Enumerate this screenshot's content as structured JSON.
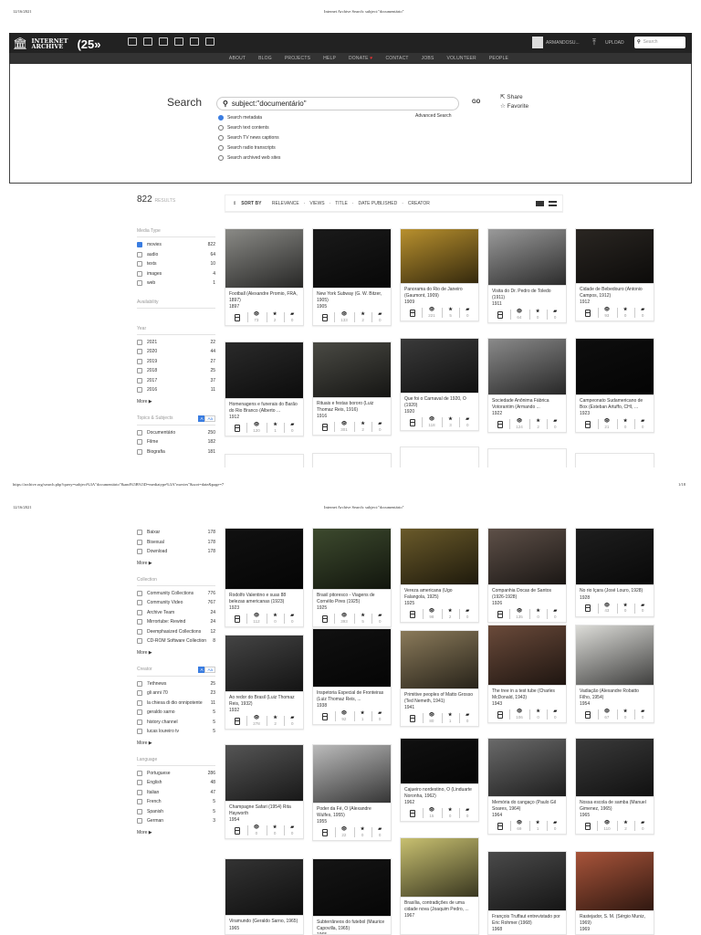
{
  "print": {
    "date": "12/16/2021",
    "title": "Internet Archive Search: subject:\"documentário\"",
    "url": "https://archive.org/search.php?query=subject%3A\"documentário\"&and%5B%5D=mediatype%3A\"movies\"&sort=date&page=7",
    "page_num": "1/18"
  },
  "nav": {
    "logo_line1": "INTERNET",
    "logo_line2": "ARCHIVE",
    "anniv": "25",
    "user": "ARMANDOSU...",
    "upload": "UPLOAD",
    "search_placeholder": "Search",
    "links": [
      "ABOUT",
      "BLOG",
      "PROJECTS",
      "HELP",
      "DONATE",
      "CONTACT",
      "JOBS",
      "VOLUNTEER",
      "PEOPLE"
    ]
  },
  "search": {
    "label": "Search",
    "query": "subject:\"documentário\"",
    "go": "GO",
    "share": "Share",
    "favorite": "Favorite",
    "advanced": "Advanced Search",
    "options": [
      "Search metadata",
      "Search text contents",
      "Search TV news captions",
      "Search radio transcripts",
      "Search archived web sites"
    ]
  },
  "results": {
    "count": "822",
    "label": "RESULTS"
  },
  "sort": {
    "label": "SORT BY",
    "options": [
      "RELEVANCE",
      "VIEWS",
      "TITLE",
      "DATE PUBLISHED",
      "CREATOR"
    ]
  },
  "facets": {
    "media": {
      "title": "Media Type",
      "items": [
        {
          "l": "movies",
          "c": "822",
          "on": true
        },
        {
          "l": "audio",
          "c": "64"
        },
        {
          "l": "texts",
          "c": "10"
        },
        {
          "l": "images",
          "c": "4"
        },
        {
          "l": "web",
          "c": "1"
        }
      ]
    },
    "availability": {
      "title": "Availability"
    },
    "year": {
      "title": "Year",
      "items": [
        {
          "l": "2021",
          "c": "22"
        },
        {
          "l": "2020",
          "c": "44"
        },
        {
          "l": "2019",
          "c": "27"
        },
        {
          "l": "2018",
          "c": "25"
        },
        {
          "l": "2017",
          "c": "37"
        },
        {
          "l": "2016",
          "c": "11"
        }
      ],
      "more": "More"
    },
    "topics": {
      "title": "Topics & Subjects",
      "items": [
        {
          "l": "Documentário",
          "c": "250"
        },
        {
          "l": "Filme",
          "c": "182"
        },
        {
          "l": "Biografia",
          "c": "181"
        }
      ]
    },
    "topics_cont": {
      "items": [
        {
          "l": "Baixar",
          "c": "178"
        },
        {
          "l": "Bisexual",
          "c": "178"
        },
        {
          "l": "Download",
          "c": "178"
        }
      ],
      "more": "More"
    },
    "collection": {
      "title": "Collection",
      "items": [
        {
          "l": "Community Collections",
          "c": "776"
        },
        {
          "l": "Community Video",
          "c": "767"
        },
        {
          "l": "Archive Team",
          "c": "24"
        },
        {
          "l": "Mirrortube: Rewind",
          "c": "24"
        },
        {
          "l": "Deemphasized Collections",
          "c": "12"
        },
        {
          "l": "CD-ROM Software Collection",
          "c": "8"
        }
      ],
      "more": "More"
    },
    "creator": {
      "title": "Creator",
      "items": [
        {
          "l": "7ethnews",
          "c": "25"
        },
        {
          "l": "gli anni 70",
          "c": "23"
        },
        {
          "l": "la chiesa di dio onnipotente",
          "c": "11"
        },
        {
          "l": "geraldo sarno",
          "c": "5"
        },
        {
          "l": "history channel",
          "c": "5"
        },
        {
          "l": "lucas loureiro tv",
          "c": "5"
        }
      ],
      "more": "More"
    },
    "language": {
      "title": "Language",
      "items": [
        {
          "l": "Portuguese",
          "c": "286"
        },
        {
          "l": "English",
          "c": "48"
        },
        {
          "l": "Italian",
          "c": "47"
        },
        {
          "l": "French",
          "c": "5"
        },
        {
          "l": "Spanish",
          "c": "5"
        },
        {
          "l": "German",
          "c": "3"
        }
      ],
      "more": "More"
    },
    "aa": "Aa"
  },
  "items": [
    {
      "t": "Football (Alexandre Promio, FRA, 1897)",
      "y": "1897",
      "v": "73",
      "f": "2",
      "r": "0"
    },
    {
      "t": "New York Subway (G. W. Bitzer, 1905)",
      "y": "1905",
      "v": "133",
      "f": "2",
      "r": "0"
    },
    {
      "t": "Panorama do Rio de Janeiro (Gaumont, 1909)",
      "y": "1909",
      "v": "221",
      "f": "5",
      "r": "0"
    },
    {
      "t": "Visita do Dr. Pedro de Toledo (1911)",
      "y": "1911",
      "v": "64",
      "f": "0",
      "r": "0"
    },
    {
      "t": "Cidade de Bebedouro (Antonio Campos, 1912)",
      "y": "1912",
      "v": "93",
      "f": "0",
      "r": "0"
    },
    {
      "t": "Homenagens e funerais do Barão do Rio Branco (Alberto ...",
      "y": "1912",
      "v": "120",
      "f": "1",
      "r": "0"
    },
    {
      "t": "Rituais e festas bororo (Luiz Thomaz Reis, 1916)",
      "y": "1916",
      "v": "301",
      "f": "2",
      "r": "0"
    },
    {
      "t": "Que foi o Carnaval de 1920, O (1920)",
      "y": "1920",
      "v": "118",
      "f": "3",
      "r": "0"
    },
    {
      "t": "Sociedade Anônima Fábrica Votorantim (Armando ...",
      "y": "1922",
      "v": "124",
      "f": "2",
      "r": "0"
    },
    {
      "t": "Campeonato Sudamericano de Box (Esteban Artuffo, CHI, ...",
      "y": "1923",
      "v": "21",
      "f": "0",
      "r": "0"
    },
    {
      "t": "Rodolfo Valentino e suas 88 belezas americanas (1923)",
      "y": "1923",
      "v": "112",
      "f": "0",
      "r": "0"
    },
    {
      "t": "Brasil pitoresco - Viagens de Cornélio Pires (1925)",
      "y": "1925",
      "v": "393",
      "f": "5",
      "r": "0"
    },
    {
      "t": "Vereza americana (Ugo Falangola, 1925)",
      "y": "1925",
      "v": "98",
      "f": "2",
      "r": "0"
    },
    {
      "t": "Companhia Docas de Santos (1926-1928)",
      "y": "1926",
      "v": "135",
      "f": "0",
      "r": "0"
    },
    {
      "t": "No rio Içara (José Louro, 1928)",
      "y": "1928",
      "v": "43",
      "f": "0",
      "r": "0"
    },
    {
      "t": "Ao redor do Brasil (Luiz Thomaz Reis, 1932)",
      "y": "1932",
      "v": "278",
      "f": "2",
      "r": "0"
    },
    {
      "t": "Inspetoria Especial de Fronteiras (Luiz Thomaz Reis, ...",
      "y": "1938",
      "v": "92",
      "f": "1",
      "r": "0"
    },
    {
      "t": "Primitive peoples of Matto Grosso (Ted Nemeth, 1941)",
      "y": "1941",
      "v": "80",
      "f": "1",
      "r": "0"
    },
    {
      "t": "The tree in a test tube (Charles McDonald, 1943)",
      "y": "1943",
      "v": "106",
      "f": "0",
      "r": "0"
    },
    {
      "t": "Vadiação (Alexandre Robatto Filho, 1954)",
      "y": "1954",
      "v": "67",
      "f": "0",
      "r": "0"
    },
    {
      "t": "Champagne Safari (1954) Rita Hayworth",
      "y": "1954",
      "v": "0",
      "f": "0",
      "r": "0"
    },
    {
      "t": "Poder da Fé, O (Alexandre Wulfes, 1955)",
      "y": "1955",
      "v": "22",
      "f": "0",
      "r": "0"
    },
    {
      "t": "Cajueiro nordestino, O (Linduarte Noronha, 1962)",
      "y": "1962",
      "v": "15",
      "f": "0",
      "r": "0"
    },
    {
      "t": "Memória do cangaço (Paulo Gil Soares, 1964)",
      "y": "1964",
      "v": "69",
      "f": "1",
      "r": "0"
    },
    {
      "t": "Nossa escola de samba (Manuel Gimenez, 1965)",
      "y": "1965",
      "v": "110",
      "f": "2",
      "r": "0"
    },
    {
      "t": "Viramundo (Geraldo Sarno, 1965)",
      "y": "1965"
    },
    {
      "t": "Subterrâneos do futebol (Maurice Capovilla, 1965)",
      "y": "1965"
    },
    {
      "t": "Brasília, contradições de uma cidade nova (Joaquim Pedro, ...",
      "y": "1967"
    },
    {
      "t": "François Truffaut entrevistado por Eric Rohmer (1968)",
      "y": "1968"
    },
    {
      "t": "Rastejador, S. M. (Sérgio Muniz, 1969)",
      "y": "1969"
    }
  ]
}
